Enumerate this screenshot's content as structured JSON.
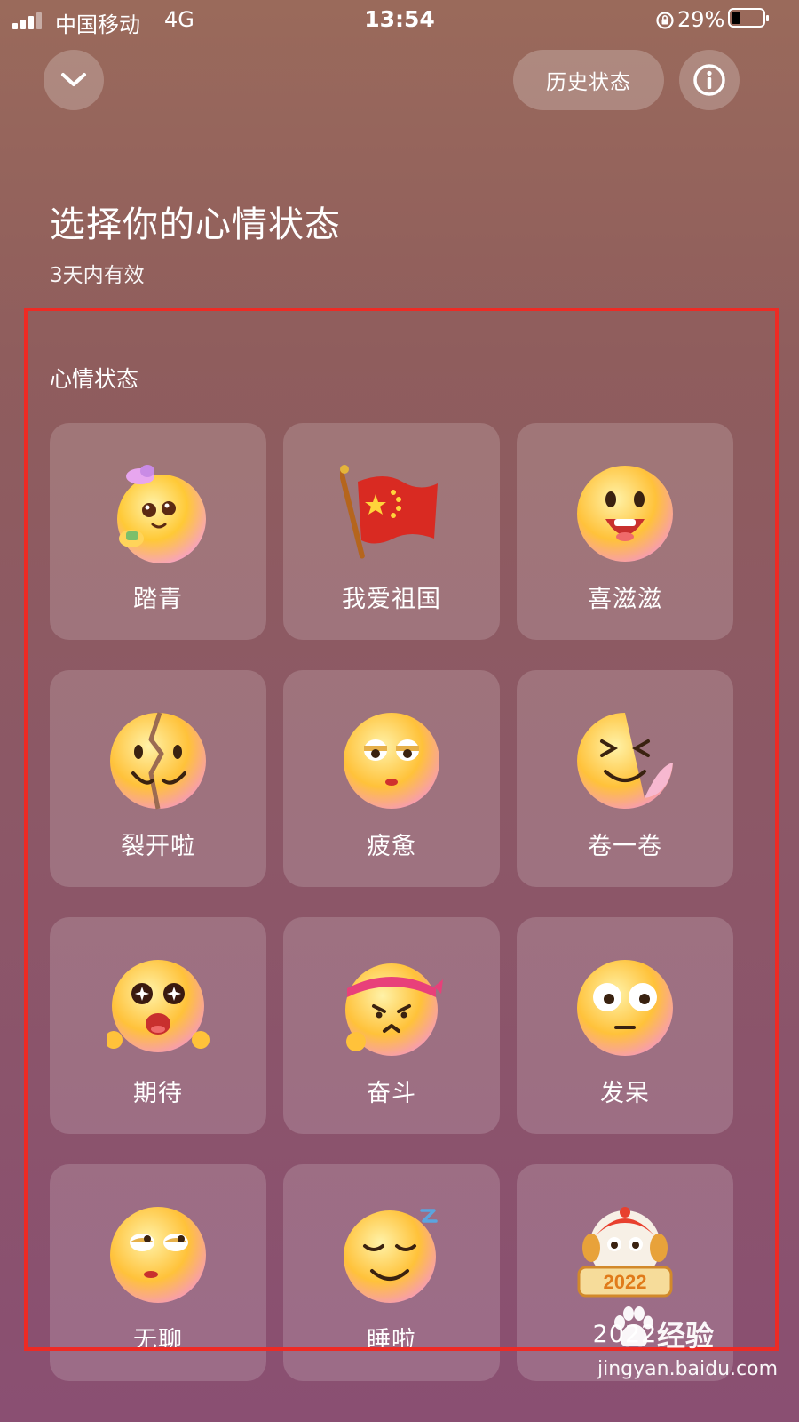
{
  "status_bar": {
    "carrier": "中国移动",
    "network": "4G",
    "time": "13:54",
    "battery_percent": "29%",
    "battery_level": 0.29
  },
  "header": {
    "back_icon": "chevron-down-icon",
    "history_label": "历史状态",
    "info_icon": "info-icon"
  },
  "page": {
    "title": "选择你的心情状态",
    "subtitle": "3天内有效"
  },
  "section": {
    "label": "心情状态"
  },
  "moods": [
    {
      "label": "踏青",
      "icon": "flower-emoji-icon"
    },
    {
      "label": "我爱祖国",
      "icon": "china-flag-icon"
    },
    {
      "label": "喜滋滋",
      "icon": "happy-face-icon"
    },
    {
      "label": "裂开啦",
      "icon": "cracked-face-icon"
    },
    {
      "label": "疲惫",
      "icon": "tired-face-icon"
    },
    {
      "label": "卷一卷",
      "icon": "curled-face-icon"
    },
    {
      "label": "期待",
      "icon": "expecting-face-icon"
    },
    {
      "label": "奋斗",
      "icon": "headband-face-icon"
    },
    {
      "label": "发呆",
      "icon": "blank-stare-face-icon"
    },
    {
      "label": "无聊",
      "icon": "bored-face-icon"
    },
    {
      "label": "睡啦",
      "icon": "sleepy-face-icon"
    },
    {
      "label": "2022",
      "icon": "lion-dance-2022-icon"
    }
  ],
  "watermark": {
    "brand": "经验",
    "url": "jingyan.baidu.com"
  },
  "colors": {
    "highlight": "#ee2a24",
    "emoji_yellow": "#ffcf3a"
  }
}
